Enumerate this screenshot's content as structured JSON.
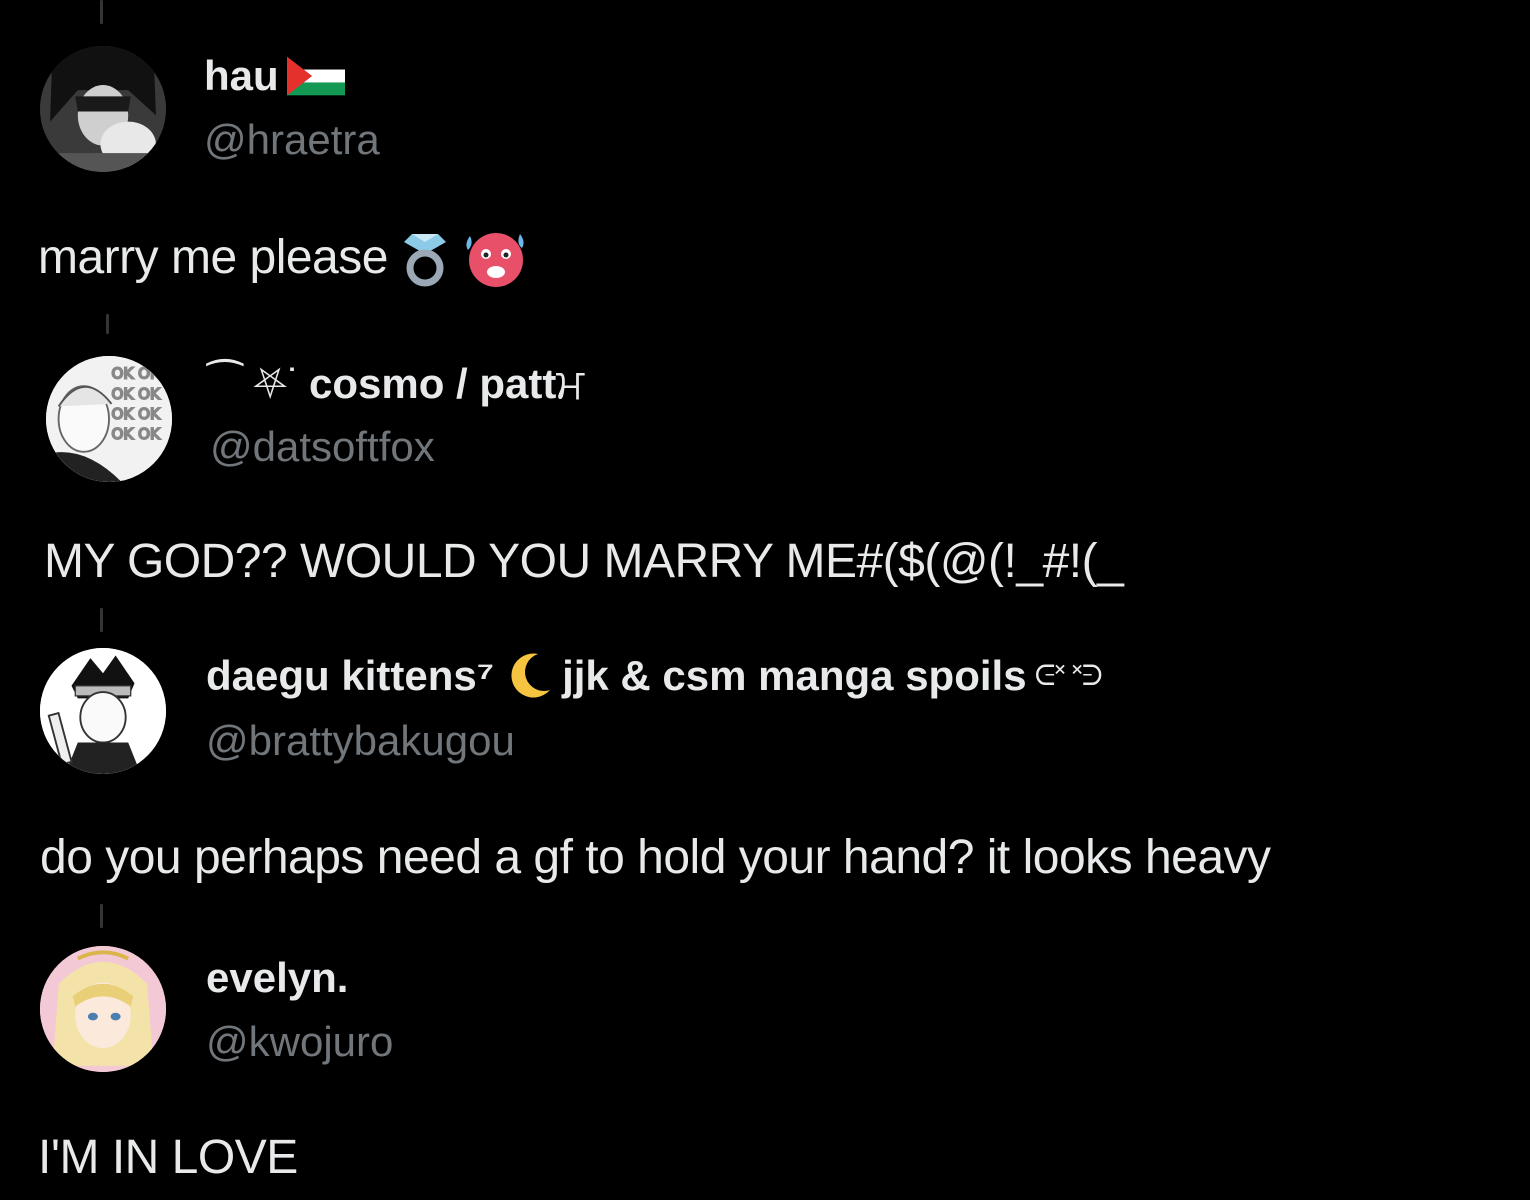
{
  "replies": [
    {
      "display_name": "hau",
      "name_icon": "palestine-flag-icon",
      "handle": "@hraetra",
      "text": "marry me please",
      "text_icons": [
        "ring-emoji-icon",
        "hot-face-emoji-icon"
      ]
    },
    {
      "display_name_prefix": "⁀ ⛧˙",
      "display_name": "cosmo / patt",
      "display_name_suffix": "ਮ",
      "handle": "@datsoftfox",
      "text": "MY GOD?? WOULD YOU MARRY ME#($(@(!_#!(_"
    },
    {
      "display_name": "daegu kittens⁷",
      "name_icon": "crescent-moon-icon",
      "display_name_rest": "jjk & csm manga spoils",
      "display_name_suffix": "ᕮ˟ ˟ᕭ",
      "handle": "@brattybakugou",
      "text": "do you perhaps need a gf to hold your hand? it looks heavy"
    },
    {
      "display_name": "evelyn.",
      "handle": "@kwojuro",
      "text": "I'M IN LOVE"
    }
  ],
  "colors": {
    "background": "#000000",
    "primary_text": "#e7e9ea",
    "secondary_text": "#71767b",
    "thread_line": "#333639"
  }
}
